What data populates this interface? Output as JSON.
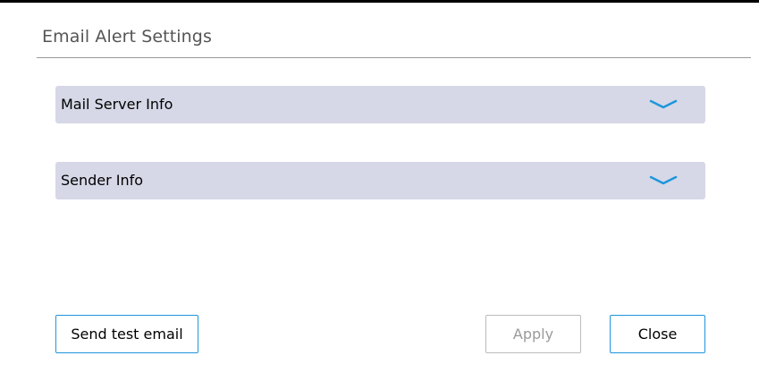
{
  "dialog": {
    "title": "Email Alert Settings"
  },
  "sections": [
    {
      "label": "Mail Server Info",
      "expanded": false,
      "icon": "chevron-down-icon"
    },
    {
      "label": "Sender Info",
      "expanded": false,
      "icon": "chevron-down-icon"
    }
  ],
  "buttons": {
    "send_test_email": "Send test email",
    "apply": "Apply",
    "apply_enabled": false,
    "close": "Close"
  },
  "colors": {
    "accent": "#1e96dc",
    "section_background": "#d6d8e7",
    "disabled_text": "#9a9a9a"
  }
}
